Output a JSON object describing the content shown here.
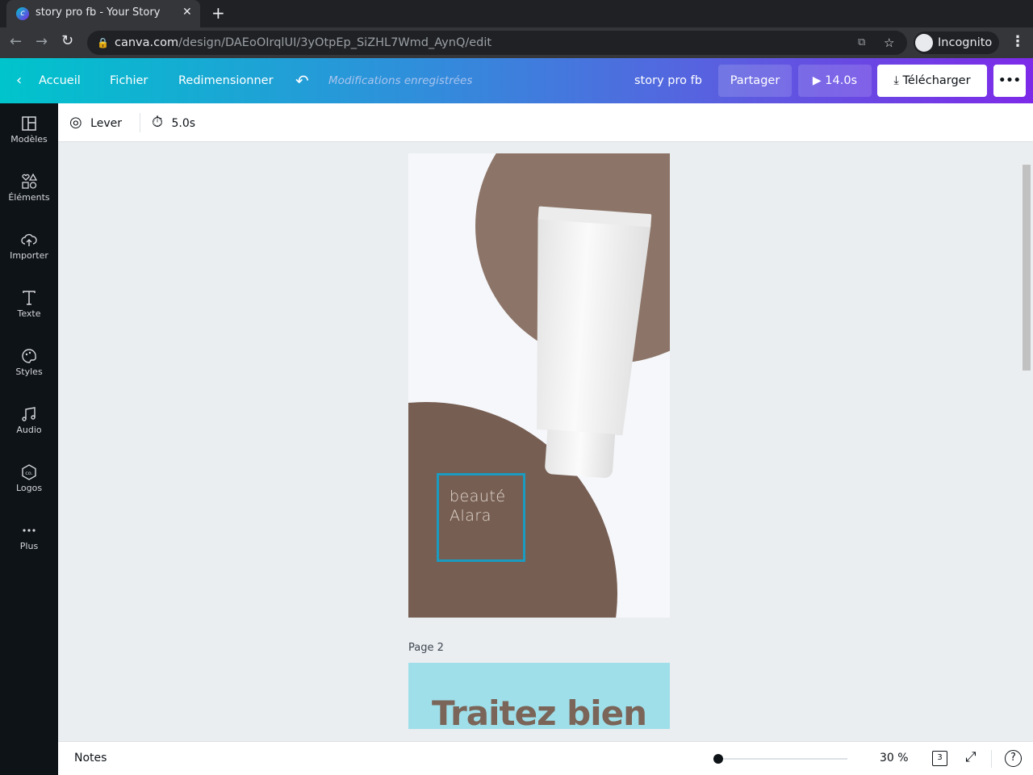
{
  "browser": {
    "tab_title": "story pro fb - Your Story",
    "url_host": "canva.com",
    "url_path": "/design/DAEoOIrqlUI/3yOtpEp_SiZHL7Wmd_AynQ/edit",
    "profile": "Incognito"
  },
  "topbar": {
    "home": "Accueil",
    "file": "Fichier",
    "resize": "Redimensionner",
    "save_status": "Modifications enregistrées",
    "design_title": "story pro fb",
    "share": "Partager",
    "play_duration": "14.0s",
    "download": "Télécharger"
  },
  "sidebar": {
    "items": [
      {
        "label": "Modèles",
        "icon": "templates-icon"
      },
      {
        "label": "Éléments",
        "icon": "elements-icon"
      },
      {
        "label": "Importer",
        "icon": "upload-icon"
      },
      {
        "label": "Texte",
        "icon": "text-icon"
      },
      {
        "label": "Styles",
        "icon": "palette-icon"
      },
      {
        "label": "Audio",
        "icon": "music-icon"
      },
      {
        "label": "Logos",
        "icon": "logo-icon"
      },
      {
        "label": "Plus",
        "icon": "more-icon"
      }
    ]
  },
  "toolbar": {
    "animation": "Lever",
    "duration": "5.0s"
  },
  "canvas": {
    "page1_text_line1": "beauté",
    "page1_text_line2": "Alara",
    "page2_label": "Page 2",
    "page2_heading": "Traitez bien",
    "colors": {
      "circle_top": "#8c7568",
      "circle_bottom": "#765e52",
      "selection": "#1a9bbf",
      "page2_bg": "#9fdfea"
    }
  },
  "bottombar": {
    "notes": "Notes",
    "zoom": "30 %",
    "page_count": "3",
    "zoom_level_percent": 30
  }
}
